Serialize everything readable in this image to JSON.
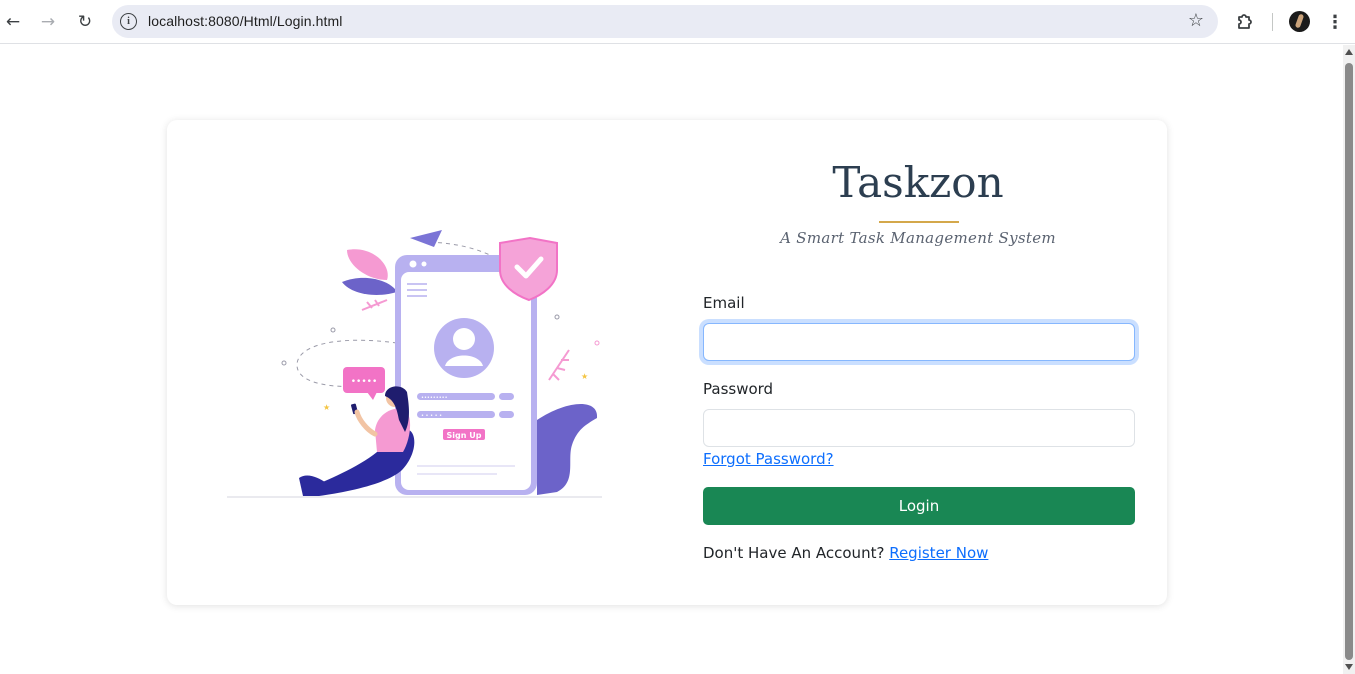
{
  "browser": {
    "url": "localhost:8080/Html/Login.html",
    "icons": {
      "back": "back-arrow-icon",
      "forward": "forward-arrow-icon",
      "reload": "reload-icon",
      "site_info": "info-icon",
      "bookmark": "star-icon",
      "extensions": "puzzle-icon",
      "profile": "avatar",
      "menu": "kebab-menu-icon"
    }
  },
  "brand": {
    "title": "Taskzon",
    "tagline": "A Smart Task Management System",
    "accent_color": "#d4a84b"
  },
  "form": {
    "email_label": "Email",
    "email_value": "",
    "password_label": "Password",
    "password_value": "",
    "forgot_link": "Forgot Password?",
    "login_button": "Login",
    "login_color": "#198754",
    "register_prompt": "Don't Have An Account?",
    "register_link": "Register Now"
  },
  "illustration": {
    "signup_label": "Sign Up",
    "password_mask": "•••••••••",
    "pin_mask": "• • • • •",
    "chat_dots": "•••••"
  }
}
